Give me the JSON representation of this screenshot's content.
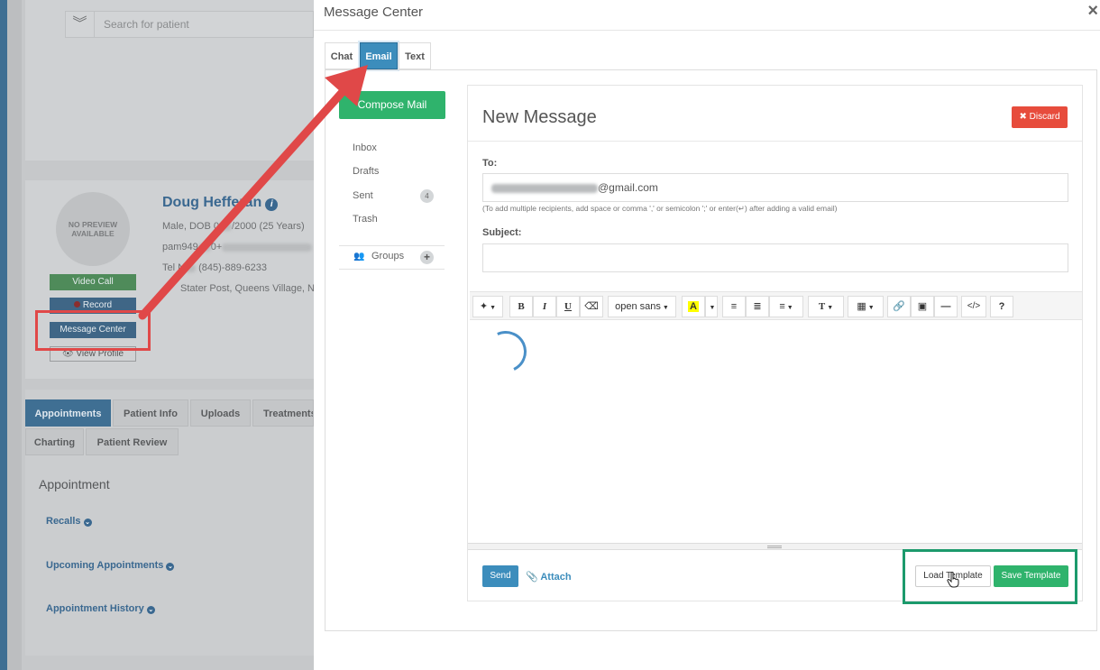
{
  "background": {
    "search_placeholder": "Search for patient",
    "avatar_text": "NO PREVIEW AVAILABLE",
    "patient_name": "Doug Hefferan",
    "patient_lines": [
      "Male, DOB 0",
      "/2000 (25 Years)",
      "pam949",
      "0+",
      "Tel N",
      "(845)-889-6233",
      "Stater Post, Queens Village, NY,"
    ],
    "buttons": {
      "video_call": "Video Call",
      "record": "Record",
      "message_center": "Message Center",
      "view_profile": "View Profile"
    },
    "tabs_row1": [
      "Appointments",
      "Patient Info",
      "Uploads",
      "Treatments"
    ],
    "tabs_row2": [
      "Charting",
      "Patient Review"
    ],
    "section_title": "Appointment",
    "links": [
      "Recalls",
      "Upcoming Appointments",
      "Appointment History"
    ]
  },
  "modal": {
    "title": "Message Center",
    "close": "×",
    "tabs": [
      "Chat",
      "Email",
      "Text"
    ],
    "active_tab": "Email",
    "sidebar": {
      "compose_label": "Compose Mail",
      "folders": [
        "Inbox",
        "Drafts",
        "Sent",
        "Trash"
      ],
      "sent_count": "4",
      "groups_label": "Groups",
      "groups_add": "+"
    },
    "compose": {
      "title": "New Message",
      "discard_label": "✖ Discard",
      "to_label": "To:",
      "to_value": "@gmail.com",
      "hint": "(To add multiple recipients, add space or comma ',' or semicolon ';' or enter(↵) after adding a valid email)",
      "subject_label": "Subject:",
      "subject_value": "",
      "toolbar": {
        "bold": "B",
        "italic": "I",
        "underline": "U",
        "font": "open sans",
        "highlight": "A",
        "font_size": "T",
        "code": "</>",
        "help": "?"
      },
      "send_label": "Send",
      "attach_label": "Attach",
      "load_template_label": "Load Template",
      "save_template_label": "Save Template"
    }
  },
  "colors": {
    "primary": "#3c8dbc",
    "success": "#2fb36c",
    "danger": "#e74c3c",
    "annotation_red": "#e04848",
    "annotation_green": "#1c9a6c"
  }
}
